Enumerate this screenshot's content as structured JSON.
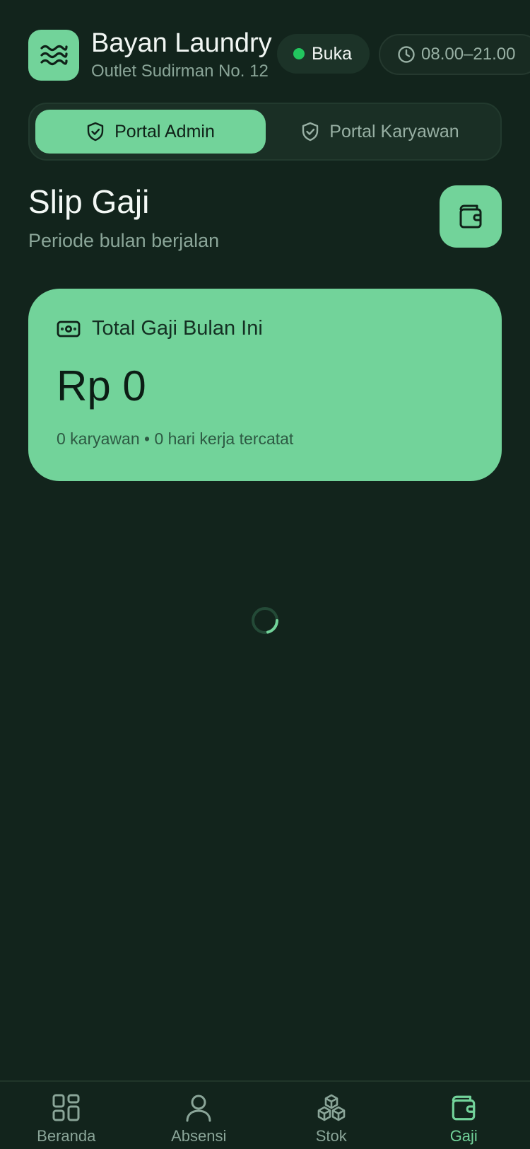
{
  "header": {
    "title": "Bayan Laundry",
    "subtitle": "Outlet Sudirman No. 12",
    "status": "Buka",
    "hours": "08.00–21.00",
    "logo_icon": "waves-icon",
    "status_color": "#22c55e"
  },
  "portal": {
    "tabs": [
      {
        "label": "Portal Admin",
        "icon": "shield-check-icon",
        "active": true
      },
      {
        "label": "Portal Karyawan",
        "icon": "shield-check-icon",
        "active": false
      }
    ]
  },
  "page": {
    "title": "Slip Gaji",
    "subtitle": "Periode bulan berjalan",
    "action_icon": "wallet-icon"
  },
  "summary": {
    "label": "Total Gaji Bulan Ini",
    "amount": "Rp 0",
    "meta": "0 karyawan • 0 hari kerja tercatat",
    "icon": "banknote-icon"
  },
  "nav": {
    "items": [
      {
        "label": "Beranda",
        "icon": "grid-icon",
        "active": false
      },
      {
        "label": "Absensi",
        "icon": "user-icon",
        "active": false
      },
      {
        "label": "Stok",
        "icon": "boxes-icon",
        "active": false
      },
      {
        "label": "Gaji",
        "icon": "wallet-icon",
        "active": true
      }
    ]
  },
  "colors": {
    "background": "#12241c",
    "accent": "#72d39a",
    "muted_text": "#8aa598"
  }
}
